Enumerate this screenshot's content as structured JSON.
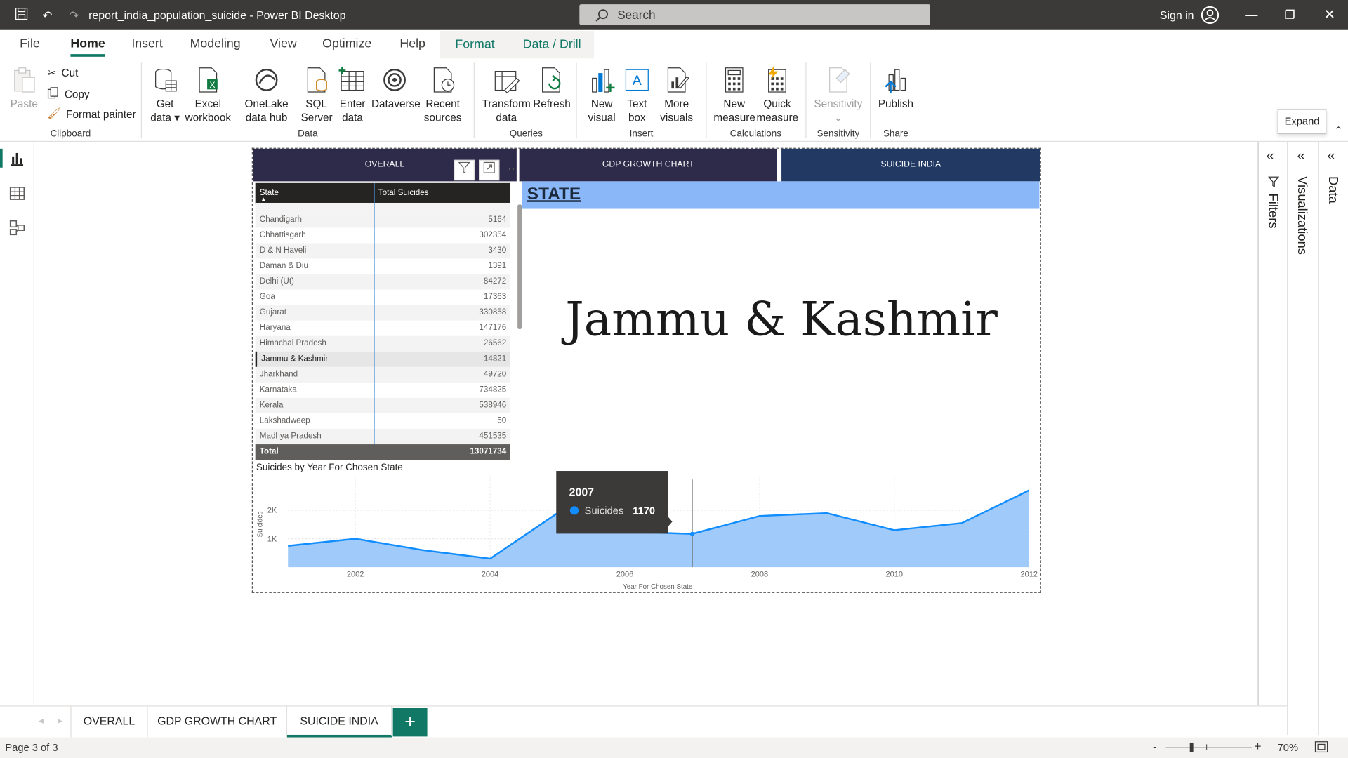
{
  "titlebar": {
    "title": "report_india_population_suicide - Power BI Desktop",
    "search_placeholder": "Search",
    "signin": "Sign in"
  },
  "menu": {
    "tabs": [
      "File",
      "Home",
      "Insert",
      "Modeling",
      "View",
      "Optimize",
      "Help",
      "Format",
      "Data / Drill"
    ],
    "active": "Home"
  },
  "ribbon": {
    "clipboard": {
      "paste": "Paste",
      "cut": "Cut",
      "copy": "Copy",
      "format_painter": "Format painter",
      "group": "Clipboard"
    },
    "data": {
      "get_data": "Get data",
      "excel": "Excel workbook",
      "onelake": "OneLake data hub",
      "sql": "SQL Server",
      "enter": "Enter data",
      "dataverse": "Dataverse",
      "recent": "Recent sources",
      "group": "Data"
    },
    "queries": {
      "transform": "Transform data",
      "refresh": "Refresh",
      "group": "Queries"
    },
    "insert": {
      "new_visual": "New visual",
      "text_box": "Text box",
      "more_visuals": "More visuals",
      "group": "Insert"
    },
    "calculations": {
      "new_measure": "New measure",
      "quick_measure": "Quick measure",
      "group": "Calculations"
    },
    "sensitivity": {
      "label": "Sensitivity",
      "group": "Sensitivity"
    },
    "share": {
      "publish": "Publish",
      "group": "Share"
    }
  },
  "report": {
    "nav_buttons": [
      "OVERALL",
      "GDP GROWTH CHART",
      "SUICIDE INDIA"
    ],
    "state_heading": "STATE",
    "selected_state": "Jammu & Kashmir",
    "table": {
      "headers": [
        "State",
        "Total Suicides"
      ],
      "rows": [
        {
          "state": "Chandigarh",
          "value": "5164"
        },
        {
          "state": "Chhattisgarh",
          "value": "302354"
        },
        {
          "state": "D & N Haveli",
          "value": "3430"
        },
        {
          "state": "Daman & Diu",
          "value": "1391"
        },
        {
          "state": "Delhi (Ut)",
          "value": "84272"
        },
        {
          "state": "Goa",
          "value": "17363"
        },
        {
          "state": "Gujarat",
          "value": "330858"
        },
        {
          "state": "Haryana",
          "value": "147176"
        },
        {
          "state": "Himachal Pradesh",
          "value": "26562"
        },
        {
          "state": "Jammu & Kashmir",
          "value": "14821"
        },
        {
          "state": "Jharkhand",
          "value": "49720"
        },
        {
          "state": "Karnataka",
          "value": "734825"
        },
        {
          "state": "Kerala",
          "value": "538946"
        },
        {
          "state": "Lakshadweep",
          "value": "50"
        },
        {
          "state": "Madhya Pradesh",
          "value": "451535"
        }
      ],
      "total_label": "Total",
      "total_value": "13071734"
    },
    "tooltip": {
      "year": "2007",
      "series": "Suicides",
      "value": "1170"
    }
  },
  "chart_data": {
    "type": "area",
    "title": "Suicides by Year For Chosen State",
    "xlabel": "Year For Chosen State",
    "ylabel": "Suicides",
    "x": [
      2001,
      2002,
      2003,
      2004,
      2005,
      2006,
      2007,
      2008,
      2009,
      2010,
      2011,
      2012
    ],
    "series": [
      {
        "name": "Suicides",
        "values": [
          750,
          1000,
          600,
          300,
          1900,
          1250,
          1170,
          1800,
          1900,
          1300,
          1550,
          2700
        ]
      }
    ],
    "ylim": [
      0,
      3200
    ],
    "yticks": [
      "1K",
      "2K"
    ],
    "xticks": [
      "2002",
      "2004",
      "2006",
      "2008",
      "2010",
      "2012"
    ],
    "grid": true,
    "color": "#118dff"
  },
  "panes": {
    "filters": "Filters",
    "visualizations": "Visualizations",
    "data": "Data",
    "expand_tip": "Expand"
  },
  "pagetabs": [
    "OVERALL",
    "GDP GROWTH CHART",
    "SUICIDE INDIA"
  ],
  "status": {
    "page": "Page 3 of 3",
    "zoom": "70%"
  },
  "colors": {
    "accent": "#117865",
    "nav_dark": "#2e2a4a",
    "nav_active": "#223a63",
    "banner": "#8ab7f8"
  }
}
